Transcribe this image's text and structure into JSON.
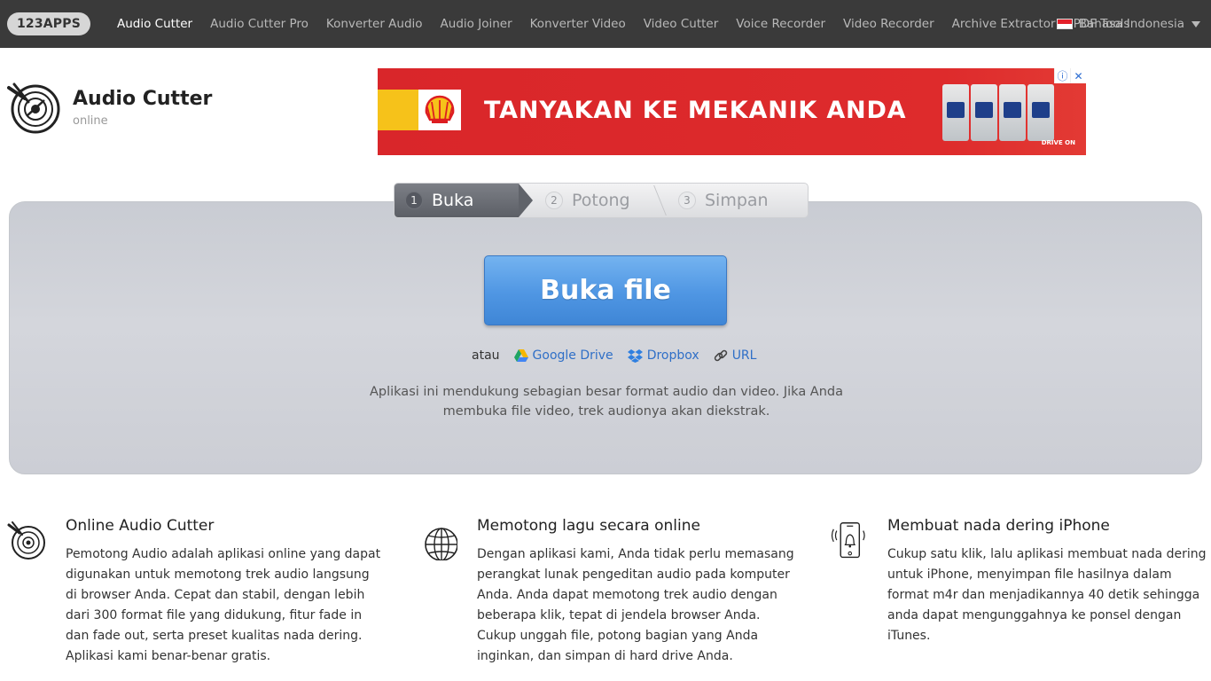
{
  "nav": {
    "brand": "123APPS",
    "links": [
      "Audio Cutter",
      "Audio Cutter Pro",
      "Konverter Audio",
      "Audio Joiner",
      "Konverter Video",
      "Video Cutter",
      "Voice Recorder",
      "Video Recorder",
      "Archive Extractor",
      "PDF Tools"
    ],
    "language": "Bahasa Indonesia"
  },
  "header": {
    "app_name": "Audio Cutter",
    "app_sub": "online"
  },
  "ad": {
    "headline": "TANYAKAN KE MEKANIK ANDA",
    "tagline": "DRIVE ON"
  },
  "steps": [
    {
      "num": "1",
      "label": "Buka"
    },
    {
      "num": "2",
      "label": "Potong"
    },
    {
      "num": "3",
      "label": "Simpan"
    }
  ],
  "open_button": "Buka file",
  "alternatives": {
    "or": "atau",
    "google_drive": "Google Drive",
    "dropbox": "Dropbox",
    "url": "URL"
  },
  "support_text": "Aplikasi ini mendukung sebagian besar format audio dan video. Jika Anda membuka file video, trek audionya akan diekstrak.",
  "features": [
    {
      "title": "Online Audio Cutter",
      "text": "Pemotong Audio adalah aplikasi online yang dapat digunakan untuk memotong trek audio langsung di browser Anda. Cepat dan stabil, dengan lebih dari 300 format file yang didukung, fitur fade in dan fade out, serta preset kualitas nada dering. Aplikasi kami benar-benar gratis."
    },
    {
      "title": "Memotong lagu secara online",
      "text": "Dengan aplikasi kami, Anda tidak perlu memasang perangkat lunak pengeditan audio pada komputer Anda. Anda dapat memotong trek audio dengan beberapa klik, tepat di jendela browser Anda. Cukup unggah file, potong bagian yang Anda inginkan, dan simpan di hard drive Anda."
    },
    {
      "title": "Membuat nada dering iPhone",
      "text": "Cukup satu klik, lalu aplikasi membuat nada dering untuk iPhone, menyimpan file hasilnya dalam format m4r dan menjadikannya 40 detik sehingga anda dapat mengunggahnya ke ponsel dengan iTunes."
    }
  ],
  "colors": {
    "nav_bg": "#3a3a3a",
    "accent_blue": "#4f96e3",
    "link_blue": "#2f6fc7",
    "ad_red": "#d9262a"
  }
}
